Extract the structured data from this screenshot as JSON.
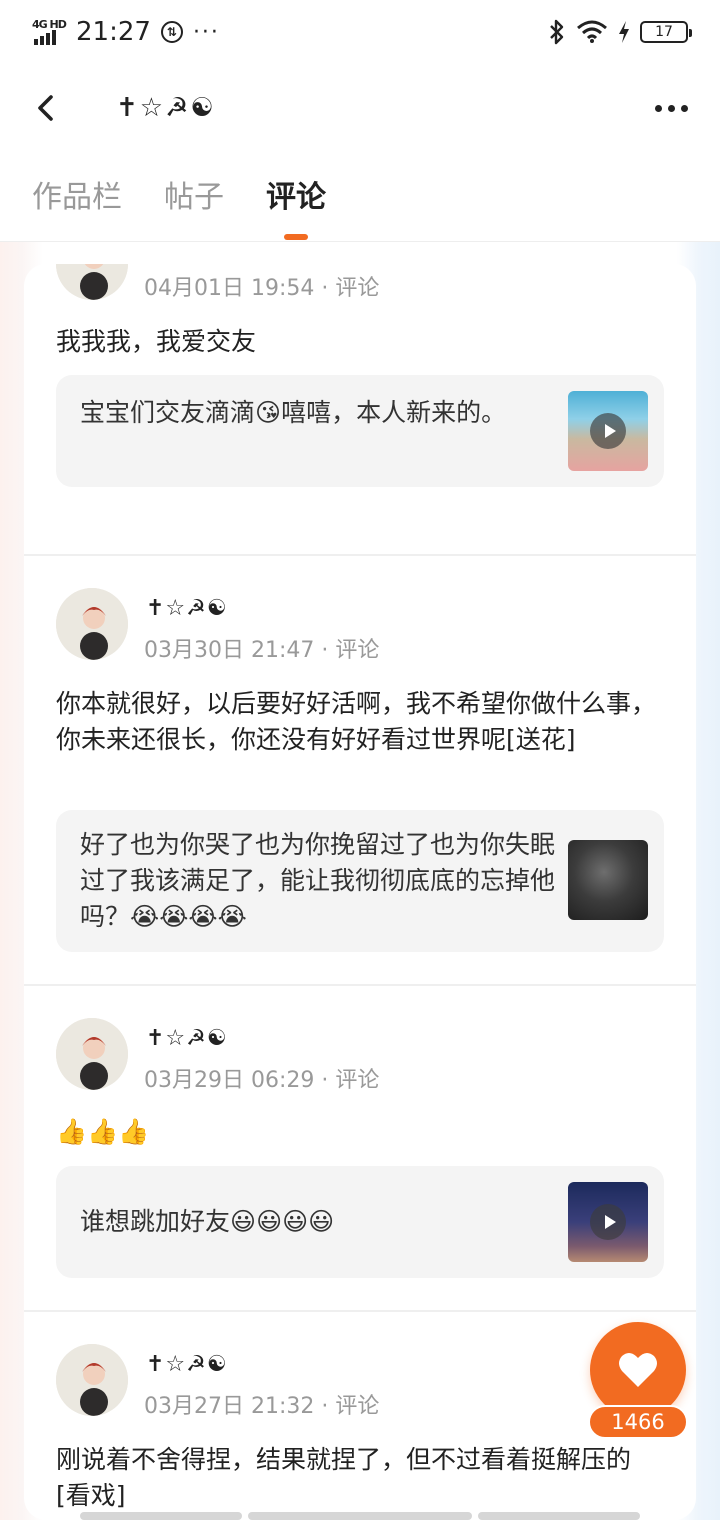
{
  "status_bar": {
    "network": "4G HD",
    "time": "21:27",
    "dots": "···",
    "battery": "17"
  },
  "header": {
    "title": "✝☆☭☯"
  },
  "tabs": [
    {
      "label": "作品栏",
      "active": false
    },
    {
      "label": "帖子",
      "active": false
    },
    {
      "label": "评论",
      "active": true
    }
  ],
  "comments": [
    {
      "name": "✝☆☭☯",
      "meta": "04月01日 19:54 · 评论",
      "text": "我我我，我爱交友",
      "quote": "宝宝们交友滴滴😘嘻嘻，本人新来的。",
      "thumb": "video-thumbnail-anime"
    },
    {
      "name": "✝☆☭☯",
      "meta": "03月30日 21:47 · 评论",
      "text": "你本就很好，以后要好好活啊，我不希望你做什么事，你未来还很长，你还没有好好看过世界呢[送花]",
      "quote": "好了也为你哭了也为你挽留过了也为你失眠过了我该满足了，能让我彻彻底底的忘掉他吗？😭😭😭😭",
      "thumb": "image-thumbnail-dark"
    },
    {
      "name": "✝☆☭☯",
      "meta": "03月29日 06:29 · 评论",
      "text": "👍👍👍",
      "quote": "谁想跳加好友😃😃😃😃",
      "thumb": "video-thumbnail-dance"
    },
    {
      "name": "✝☆☭☯",
      "meta": "03月27日 21:32 · 评论",
      "text": "刚说着不舍得捏，结果就捏了，但不过看着挺解压的[看戏]"
    }
  ],
  "like": {
    "count": "1466",
    "icon": "heart-icon"
  },
  "colors": {
    "accent": "#f26b21"
  }
}
